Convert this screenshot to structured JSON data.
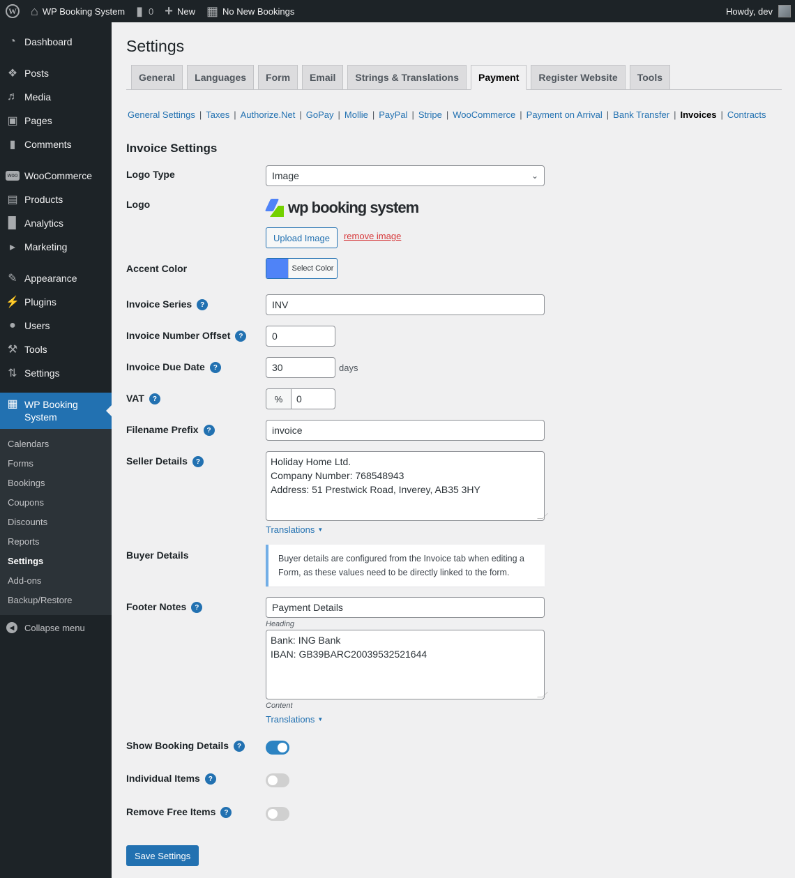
{
  "adminbar": {
    "site_name": "WP Booking System",
    "comments_count": "0",
    "new_label": "New",
    "bookings_label": "No New Bookings",
    "greeting": "Howdy, dev"
  },
  "sidebar": {
    "items": [
      {
        "label": "Dashboard",
        "icon": "dashboard-icon"
      },
      {
        "label": "Posts",
        "icon": "pin-icon"
      },
      {
        "label": "Media",
        "icon": "media-icon"
      },
      {
        "label": "Pages",
        "icon": "pages-icon"
      },
      {
        "label": "Comments",
        "icon": "comment-icon"
      },
      {
        "label": "WooCommerce",
        "icon": "woo-icon"
      },
      {
        "label": "Products",
        "icon": "archive-icon"
      },
      {
        "label": "Analytics",
        "icon": "bar-chart-icon"
      },
      {
        "label": "Marketing",
        "icon": "megaphone-icon"
      },
      {
        "label": "Appearance",
        "icon": "paintbrush-icon"
      },
      {
        "label": "Plugins",
        "icon": "plug-icon"
      },
      {
        "label": "Users",
        "icon": "user-icon"
      },
      {
        "label": "Tools",
        "icon": "wrench-icon"
      },
      {
        "label": "Settings",
        "icon": "sliders-icon"
      },
      {
        "label": "WP Booking System",
        "icon": "calendar-icon"
      }
    ],
    "submenu": [
      "Calendars",
      "Forms",
      "Bookings",
      "Coupons",
      "Discounts",
      "Reports",
      "Settings",
      "Add-ons",
      "Backup/Restore"
    ],
    "submenu_active": "Settings",
    "collapse_label": "Collapse menu"
  },
  "page": {
    "title": "Settings",
    "tabs": [
      "General",
      "Languages",
      "Form",
      "Email",
      "Strings & Translations",
      "Payment",
      "Register Website",
      "Tools"
    ],
    "active_tab": "Payment",
    "subnav": [
      "General Settings",
      "Taxes",
      "Authorize.Net",
      "GoPay",
      "Mollie",
      "PayPal",
      "Stripe",
      "WooCommerce",
      "Payment on Arrival",
      "Bank Transfer",
      "Invoices",
      "Contracts"
    ],
    "active_subnav": "Invoices",
    "section_title": "Invoice Settings"
  },
  "form": {
    "logo_type": {
      "label": "Logo Type",
      "value": "Image"
    },
    "logo": {
      "label": "Logo",
      "wordmark": "wp booking system",
      "upload_label": "Upload Image",
      "remove_label": "remove image"
    },
    "accent_color": {
      "label": "Accent Color",
      "value": "#4f83f7",
      "button_label": "Select Color"
    },
    "invoice_series": {
      "label": "Invoice Series",
      "value": "INV"
    },
    "invoice_number_offset": {
      "label": "Invoice Number Offset",
      "value": "0"
    },
    "invoice_due_date": {
      "label": "Invoice Due Date",
      "value": "30",
      "suffix": "days"
    },
    "vat": {
      "label": "VAT",
      "unit": "%",
      "value": "0"
    },
    "filename_prefix": {
      "label": "Filename Prefix",
      "value": "invoice"
    },
    "seller_details": {
      "label": "Seller Details",
      "lines": [
        "Holiday Home Ltd.",
        "Company Number: 768548943",
        "Address: 51 Prestwick Road, Inverey, AB35 3HY"
      ],
      "translations_label": "Translations"
    },
    "buyer_details": {
      "label": "Buyer Details",
      "notice": "Buyer details are configured from the Invoice tab when editing a Form, as these values need to be directly linked to the form."
    },
    "footer_notes": {
      "label": "Footer Notes",
      "heading_value": "Payment Details",
      "heading_hint": "Heading",
      "content_lines": [
        "Bank: ING Bank",
        "IBAN: GB39BARC20039532521644"
      ],
      "content_hint": "Content",
      "translations_label": "Translations"
    },
    "show_booking_details": {
      "label": "Show Booking Details",
      "enabled": true
    },
    "individual_items": {
      "label": "Individual Items",
      "enabled": false
    },
    "remove_free_items": {
      "label": "Remove Free Items",
      "enabled": false
    },
    "save_label": "Save Settings",
    "help_glyph": "?"
  }
}
